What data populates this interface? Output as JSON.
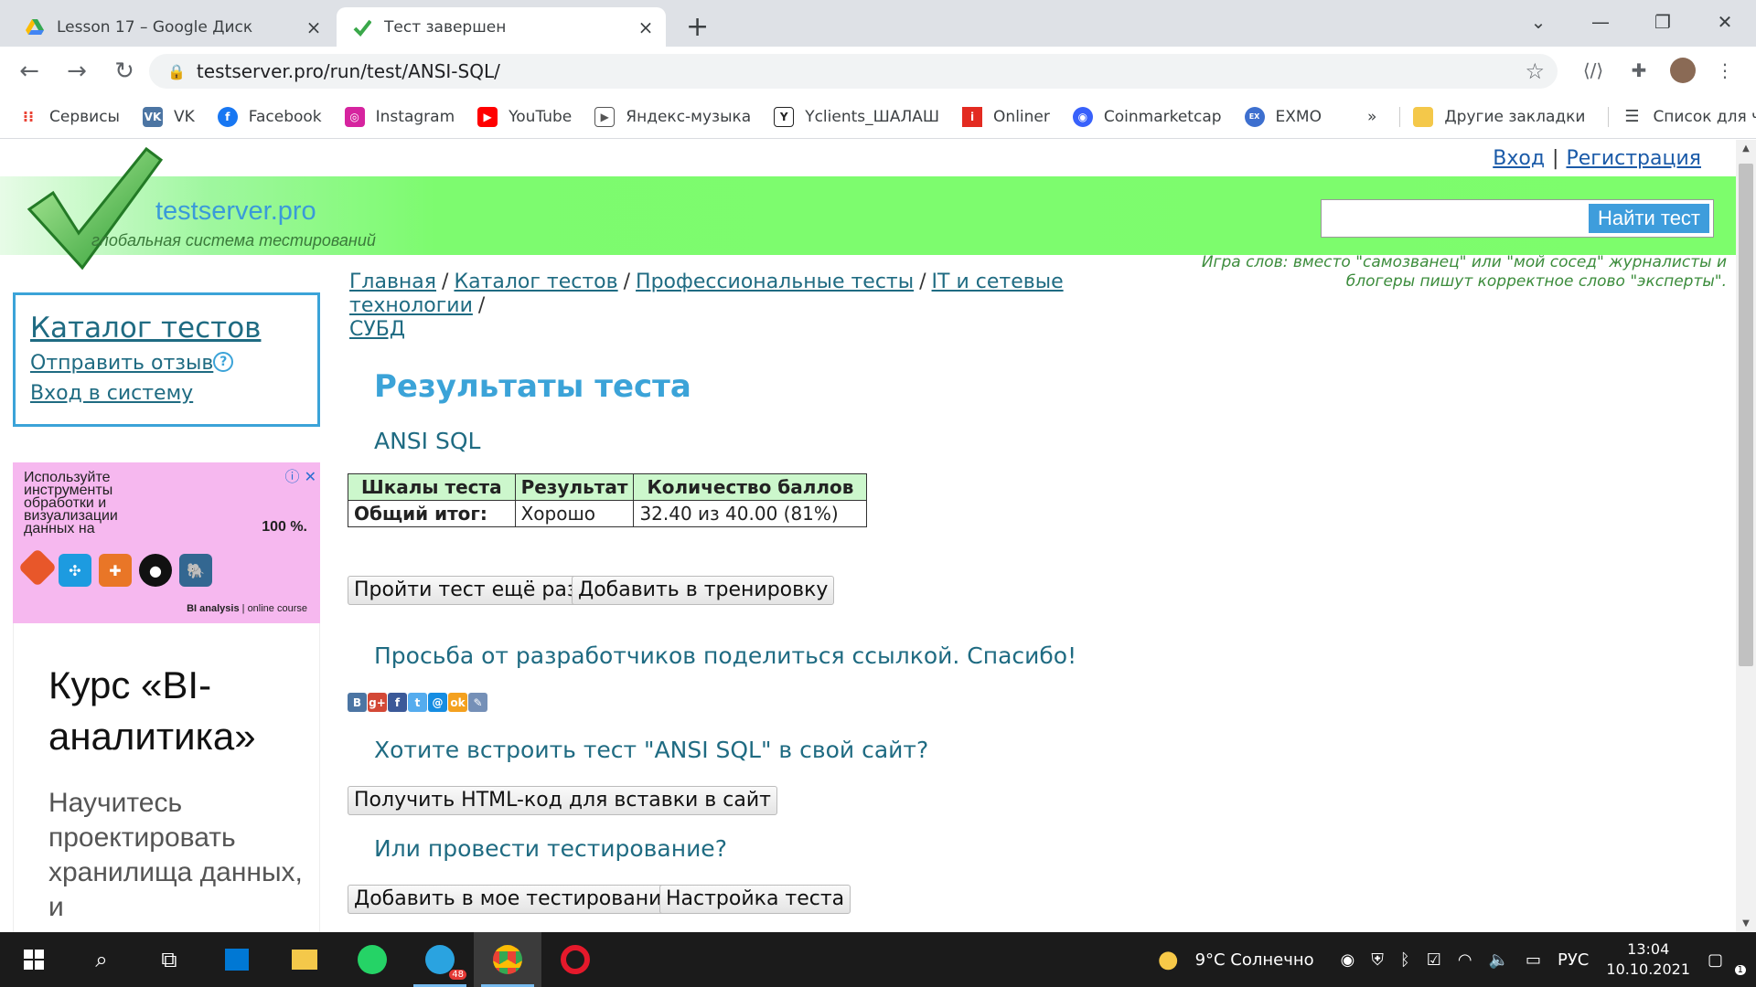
{
  "browser": {
    "tabs": [
      {
        "title": "Lesson 17 – Google Диск",
        "icon": "google-drive-icon"
      },
      {
        "title": "Тест завершен",
        "icon": "testserver-check-icon"
      }
    ],
    "url": "testserver.pro/run/test/ANSI-SQL/",
    "bookmarks": [
      {
        "label": "Сервисы",
        "icon": "apps-grid-icon",
        "color": "#ea4335"
      },
      {
        "label": "VK",
        "icon": "vk-icon",
        "color": "#4c75a3"
      },
      {
        "label": "Facebook",
        "icon": "facebook-icon",
        "color": "#1877f2"
      },
      {
        "label": "Instagram",
        "icon": "instagram-icon",
        "color": "#d6249f"
      },
      {
        "label": "YouTube",
        "icon": "youtube-icon",
        "color": "#ff0000"
      },
      {
        "label": "Яндекс-музыка",
        "icon": "yandex-music-icon",
        "color": "#555555"
      },
      {
        "label": "Yclients_ШАЛАШ",
        "icon": "yclients-icon",
        "color": "#222222"
      },
      {
        "label": "Onliner",
        "icon": "onliner-icon",
        "color": "#e32b21"
      },
      {
        "label": "Coinmarketcap",
        "icon": "coinmarketcap-icon",
        "color": "#3861fb"
      },
      {
        "label": "EXMO",
        "icon": "exmo-icon",
        "color": "#3d6fcf"
      }
    ],
    "more_label": "»",
    "other_bookmarks": "Другие закладки",
    "reading_list": "Список для чтения"
  },
  "site": {
    "login": "Вход",
    "separator": "|",
    "register": "Регистрация",
    "logo_name": "testserver.pro",
    "logo_sub": "глобальная система тестирований",
    "search_button": "Найти тест",
    "quote": "Игра слов: вместо \"самозванец\" или \"мой сосед\" журналисты и блогеры пишут корректное слово \"эксперты\".",
    "sidebar": {
      "catalog": "Каталог тестов",
      "feedback": "Отправить отзыв",
      "help": "?",
      "login": "Вход в систему"
    },
    "ad": {
      "text": "Используйте инструменты обработки и визуализации данных на",
      "percent": "100 %.",
      "footer_brand": "BI analysis",
      "footer_rest": " | online course",
      "headline": "Курс «BI-аналитика»",
      "body": "Научитесь проектировать хранилища данных, и"
    },
    "breadcrumbs": [
      "Главная",
      "Каталог тестов",
      "Профессиональные тесты",
      "IT и сетевые технологии",
      "СУБД"
    ],
    "breadcrumb_sep": "/",
    "results_title": "Результаты теста",
    "test_name": "ANSI SQL",
    "table": {
      "headers": [
        "Шкалы теста",
        "Результат",
        "Количество баллов"
      ],
      "row": [
        "Общий итог:",
        "Хорошо",
        "32.40 из 40.00 (81%)"
      ]
    },
    "retry_button": "Пройти тест ещё раз",
    "training_button": "Добавить в тренировку",
    "share_text": "Просьба от разработчиков поделиться ссылкой. Спасибо!",
    "share_icons": [
      {
        "name": "vk",
        "glyph": "B",
        "color": "#4c75a3"
      },
      {
        "name": "google-plus",
        "glyph": "g+",
        "color": "#d34836"
      },
      {
        "name": "facebook",
        "glyph": "f",
        "color": "#3b5998"
      },
      {
        "name": "twitter",
        "glyph": "t",
        "color": "#55acee"
      },
      {
        "name": "mail-ru",
        "glyph": "@",
        "color": "#168de2"
      },
      {
        "name": "odnoklassniki",
        "glyph": "ok",
        "color": "#f4a11f"
      },
      {
        "name": "livejournal",
        "glyph": "✎",
        "color": "#7590b7"
      }
    ],
    "embed_question": "Хотите встроить тест \"ANSI SQL\" в свой сайт?",
    "embed_button": "Получить HTML-код для вставки в сайт",
    "testing_question": "Или провести тестирование?",
    "add_testing_button": "Добавить в мое тестирование",
    "settings_button": "Настройка теста"
  },
  "taskbar": {
    "weather": "9°C  Солнечно",
    "language": "РУС",
    "time": "13:04",
    "date": "10.10.2021",
    "telegram_badge": "48",
    "notifications": "1"
  }
}
